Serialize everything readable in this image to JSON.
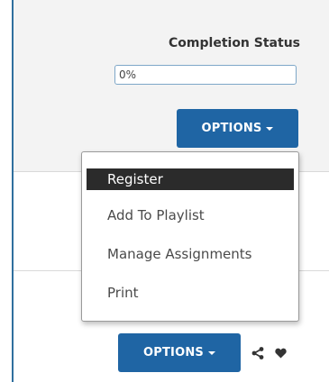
{
  "completion": {
    "label": "Completion Status",
    "value": "0%"
  },
  "options_top": {
    "label": "OPTIONS"
  },
  "menu": {
    "items": [
      {
        "label": "Register",
        "selected": true
      },
      {
        "label": "Add To Playlist",
        "selected": false
      },
      {
        "label": "Manage Assignments",
        "selected": false
      },
      {
        "label": "Print",
        "selected": false
      }
    ]
  },
  "options_bottom": {
    "label": "OPTIONS"
  },
  "icons": {
    "share": "share-icon",
    "favorite": "heart-icon"
  },
  "colors": {
    "button": "#1f65a4",
    "selected_item": "#2b2b2b"
  }
}
